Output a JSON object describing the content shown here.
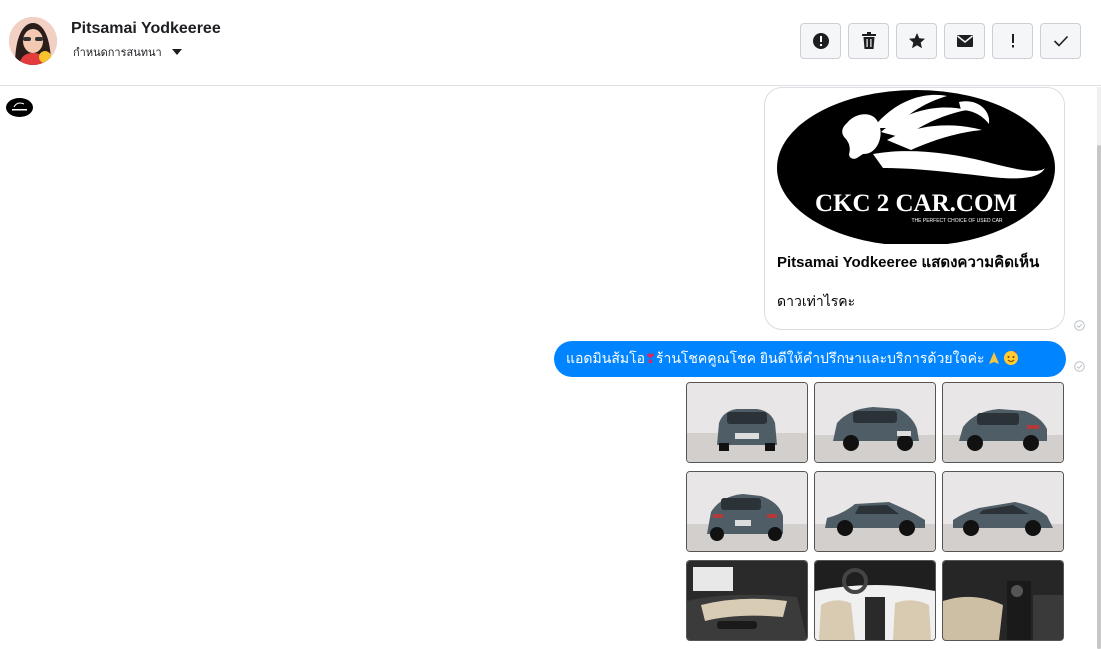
{
  "header": {
    "contact_name": "Pitsamai Yodkeeree",
    "assign_label": "กำหนดการสนทนา",
    "actions": [
      {
        "name": "mark-spam-button",
        "icon": "alert-circle-icon"
      },
      {
        "name": "delete-button",
        "icon": "trash-icon"
      },
      {
        "name": "star-button",
        "icon": "star-icon"
      },
      {
        "name": "mark-unread-button",
        "icon": "envelope-icon"
      },
      {
        "name": "follow-up-button",
        "icon": "exclamation-icon"
      },
      {
        "name": "mark-done-button",
        "icon": "checkmark-icon"
      }
    ]
  },
  "card": {
    "logo_text": "CKC 2 CAR.COM",
    "logo_tagline": "THE PERFECT CHOICE OF USED CAR",
    "title": "Pitsamai Yodkeeree แสดงความคิดเห็น",
    "body": "ดาวเท่าไรคะ"
  },
  "message": {
    "text_part1": "แอดมินส้มโอ",
    "heart": "❣",
    "text_part2": " ร้านโชคคูณโชค ยินดีให้คำปรึกษาและบริการด้วยใจค่ะ"
  },
  "photos": [
    {
      "name": "photo-car-front"
    },
    {
      "name": "photo-car-front-quarter"
    },
    {
      "name": "photo-car-rear-quarter"
    },
    {
      "name": "photo-car-rear"
    },
    {
      "name": "photo-car-side-right"
    },
    {
      "name": "photo-car-side-left"
    },
    {
      "name": "photo-door-interior"
    },
    {
      "name": "photo-dashboard"
    },
    {
      "name": "photo-console"
    }
  ],
  "colors": {
    "accent": "#0084ff",
    "border": "#dadde1"
  }
}
